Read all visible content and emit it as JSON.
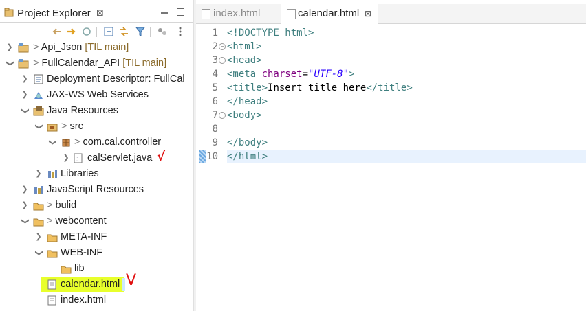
{
  "explorer": {
    "title": "Project Explorer",
    "close": "⊠",
    "tree": [
      {
        "label": "Api_Json",
        "decoration": "[TIL main]",
        "prefix": ">"
      },
      {
        "label": "FullCalendar_API",
        "decoration": "[TIL main]",
        "prefix": ""
      },
      {
        "label": "Deployment Descriptor: FullCal"
      },
      {
        "label": "JAX-WS Web Services"
      },
      {
        "label": "Java Resources"
      },
      {
        "label": "src",
        "prefix": ">"
      },
      {
        "label": "com.cal.controller",
        "prefix": ">"
      },
      {
        "label": "calServlet.java"
      },
      {
        "label": "Libraries"
      },
      {
        "label": "JavaScript Resources"
      },
      {
        "label": "bulid",
        "prefix": ">"
      },
      {
        "label": "webcontent",
        "prefix": ">"
      },
      {
        "label": "META-INF"
      },
      {
        "label": "WEB-INF"
      },
      {
        "label": "lib"
      },
      {
        "label": "calendar.html"
      },
      {
        "label": "index.html"
      }
    ],
    "annotations": {
      "check_small": "√",
      "check_large": "V"
    }
  },
  "editor": {
    "tabs": [
      {
        "label": "index.html",
        "active": false
      },
      {
        "label": "calendar.html",
        "active": true,
        "close": "⊠"
      }
    ],
    "line_numbers": [
      "1",
      "2",
      "3",
      "4",
      "5",
      "6",
      "7",
      "8",
      "9",
      "10"
    ],
    "lines": [
      {
        "parts": [
          [
            "tag",
            "<!DOCTYPE html>"
          ]
        ]
      },
      {
        "parts": [
          [
            "tag",
            "<html>"
          ]
        ]
      },
      {
        "parts": [
          [
            "tag",
            "<head>"
          ]
        ]
      },
      {
        "parts": [
          [
            "tag",
            "<meta "
          ],
          [
            "attr",
            "charset"
          ],
          [
            "txt",
            "="
          ],
          [
            "val",
            "\"UTF-8\""
          ],
          [
            "tag",
            ">"
          ]
        ]
      },
      {
        "parts": [
          [
            "tag",
            "<title>"
          ],
          [
            "txt",
            "Insert title here"
          ],
          [
            "tag",
            "</title>"
          ]
        ]
      },
      {
        "parts": [
          [
            "tag",
            "</head>"
          ]
        ]
      },
      {
        "parts": [
          [
            "tag",
            "<body>"
          ]
        ]
      },
      {
        "parts": []
      },
      {
        "parts": [
          [
            "tag",
            "</body>"
          ]
        ]
      },
      {
        "parts": [
          [
            "tag",
            "</html>"
          ]
        ]
      }
    ]
  }
}
